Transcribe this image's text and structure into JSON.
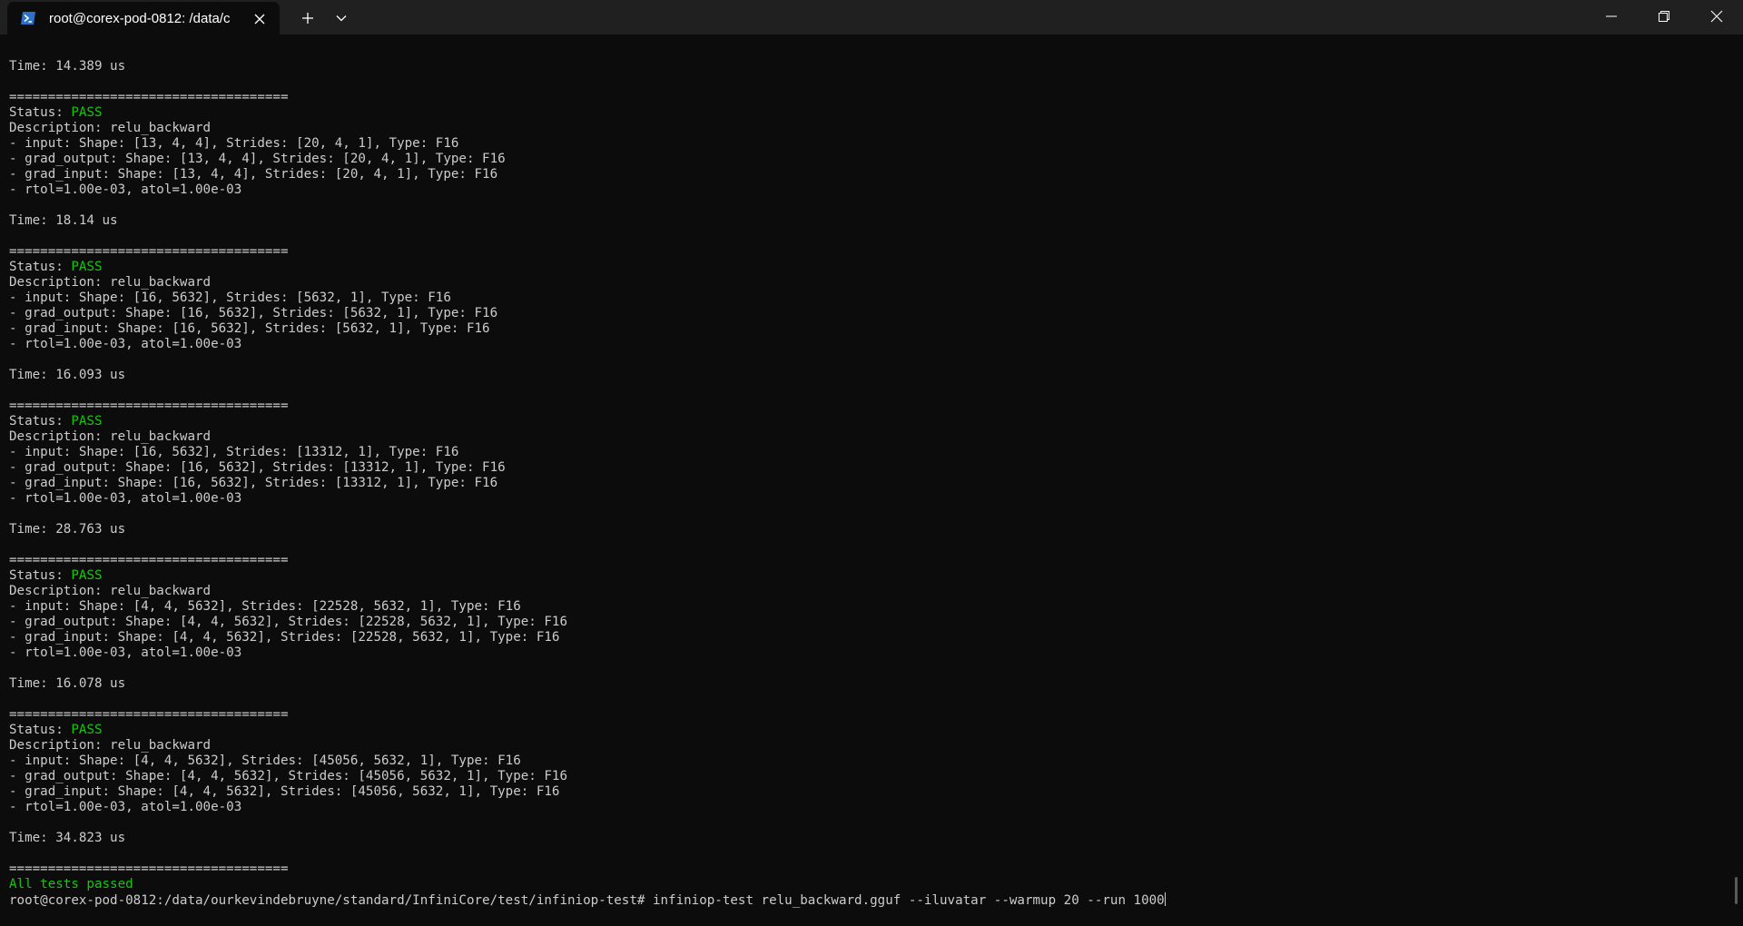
{
  "tab": {
    "title": "root@corex-pod-0812: /data/c",
    "icon": "powershell-icon",
    "close_glyph": "✕",
    "new_tab_glyph": "+",
    "dropdown_glyph": "⌄"
  },
  "colors": {
    "background": "#0c0c0c",
    "titlebar": "#202020",
    "text": "#cccccc",
    "pass": "#16c60c"
  },
  "terminal": {
    "lines": [
      {
        "text": "Time: 14.389 us"
      },
      {
        "text": ""
      },
      {
        "text": "===================================="
      },
      {
        "prefix": "Status: ",
        "status": "PASS"
      },
      {
        "text": "Description: relu_backward"
      },
      {
        "text": "- input: Shape: [13, 4, 4], Strides: [20, 4, 1], Type: F16"
      },
      {
        "text": "- grad_output: Shape: [13, 4, 4], Strides: [20, 4, 1], Type: F16"
      },
      {
        "text": "- grad_input: Shape: [13, 4, 4], Strides: [20, 4, 1], Type: F16"
      },
      {
        "text": "- rtol=1.00e-03, atol=1.00e-03"
      },
      {
        "text": ""
      },
      {
        "text": "Time: 18.14 us"
      },
      {
        "text": ""
      },
      {
        "text": "===================================="
      },
      {
        "prefix": "Status: ",
        "status": "PASS"
      },
      {
        "text": "Description: relu_backward"
      },
      {
        "text": "- input: Shape: [16, 5632], Strides: [5632, 1], Type: F16"
      },
      {
        "text": "- grad_output: Shape: [16, 5632], Strides: [5632, 1], Type: F16"
      },
      {
        "text": "- grad_input: Shape: [16, 5632], Strides: [5632, 1], Type: F16"
      },
      {
        "text": "- rtol=1.00e-03, atol=1.00e-03"
      },
      {
        "text": ""
      },
      {
        "text": "Time: 16.093 us"
      },
      {
        "text": ""
      },
      {
        "text": "===================================="
      },
      {
        "prefix": "Status: ",
        "status": "PASS"
      },
      {
        "text": "Description: relu_backward"
      },
      {
        "text": "- input: Shape: [16, 5632], Strides: [13312, 1], Type: F16"
      },
      {
        "text": "- grad_output: Shape: [16, 5632], Strides: [13312, 1], Type: F16"
      },
      {
        "text": "- grad_input: Shape: [16, 5632], Strides: [13312, 1], Type: F16"
      },
      {
        "text": "- rtol=1.00e-03, atol=1.00e-03"
      },
      {
        "text": ""
      },
      {
        "text": "Time: 28.763 us"
      },
      {
        "text": ""
      },
      {
        "text": "===================================="
      },
      {
        "prefix": "Status: ",
        "status": "PASS"
      },
      {
        "text": "Description: relu_backward"
      },
      {
        "text": "- input: Shape: [4, 4, 5632], Strides: [22528, 5632, 1], Type: F16"
      },
      {
        "text": "- grad_output: Shape: [4, 4, 5632], Strides: [22528, 5632, 1], Type: F16"
      },
      {
        "text": "- grad_input: Shape: [4, 4, 5632], Strides: [22528, 5632, 1], Type: F16"
      },
      {
        "text": "- rtol=1.00e-03, atol=1.00e-03"
      },
      {
        "text": ""
      },
      {
        "text": "Time: 16.078 us"
      },
      {
        "text": ""
      },
      {
        "text": "===================================="
      },
      {
        "prefix": "Status: ",
        "status": "PASS"
      },
      {
        "text": "Description: relu_backward"
      },
      {
        "text": "- input: Shape: [4, 4, 5632], Strides: [45056, 5632, 1], Type: F16"
      },
      {
        "text": "- grad_output: Shape: [4, 4, 5632], Strides: [45056, 5632, 1], Type: F16"
      },
      {
        "text": "- grad_input: Shape: [4, 4, 5632], Strides: [45056, 5632, 1], Type: F16"
      },
      {
        "text": "- rtol=1.00e-03, atol=1.00e-03"
      },
      {
        "text": ""
      },
      {
        "text": "Time: 34.823 us"
      },
      {
        "text": ""
      },
      {
        "text": "===================================="
      },
      {
        "status": "All tests passed"
      },
      {
        "prompt": "root@corex-pod-0812:/data/ourkevindebruyne/standard/InfiniCore/test/infiniop-test# ",
        "command": "infiniop-test relu_backward.gguf --iluvatar --warmup 20 --run 1000"
      }
    ]
  }
}
